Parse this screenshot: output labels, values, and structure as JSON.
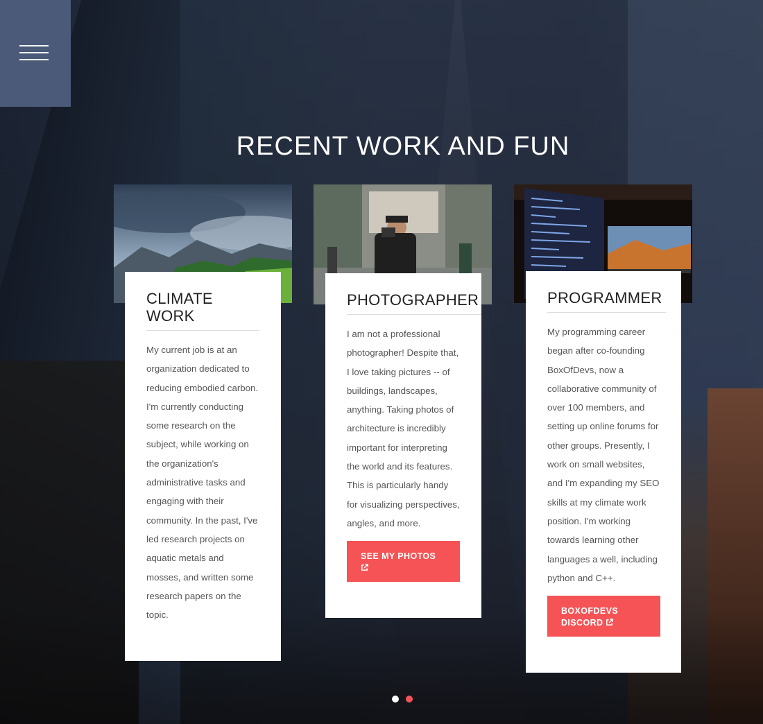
{
  "nav": {
    "menu_icon": "hamburger-icon"
  },
  "section": {
    "title": "RECENT WORK AND FUN"
  },
  "cards": [
    {
      "title": "CLIMATE WORK",
      "body": "My current job is at an organization dedicated to reducing embodied carbon. I'm currently conducting some research on the subject, while working on the organization's administrative tasks and engaging with their community. In the past, I've led research projects on aquatic metals and mosses, and written some research papers on the topic."
    },
    {
      "title": "PHOTOGRAPHER",
      "body": "I am not a professional photographer! Despite that, I love taking pictures -- of buildings, landscapes, anything. Taking photos of architecture is incredibly important for interpreting the world and its features. This is particularly handy for visualizing perspectives, angles, and more.",
      "button": "SEE MY PHOTOS",
      "button_icon": "external-link-icon"
    },
    {
      "title": "PROGRAMMER",
      "body": "My programming career began after co-founding BoxOfDevs, now a collaborative community of over 100 members, and setting up online forums for other groups. Presently, I work on small websites, and I'm expanding my SEO skills at my climate work position. I'm working towards learning other languages a well, including python and C++.",
      "button": "BOXOFDEVS DISCORD",
      "button_icon": "external-link-icon"
    }
  ],
  "pagination": {
    "total": 2,
    "active": 2
  },
  "colors": {
    "accent": "#f55356",
    "menu_bg": "#4a5a78"
  }
}
